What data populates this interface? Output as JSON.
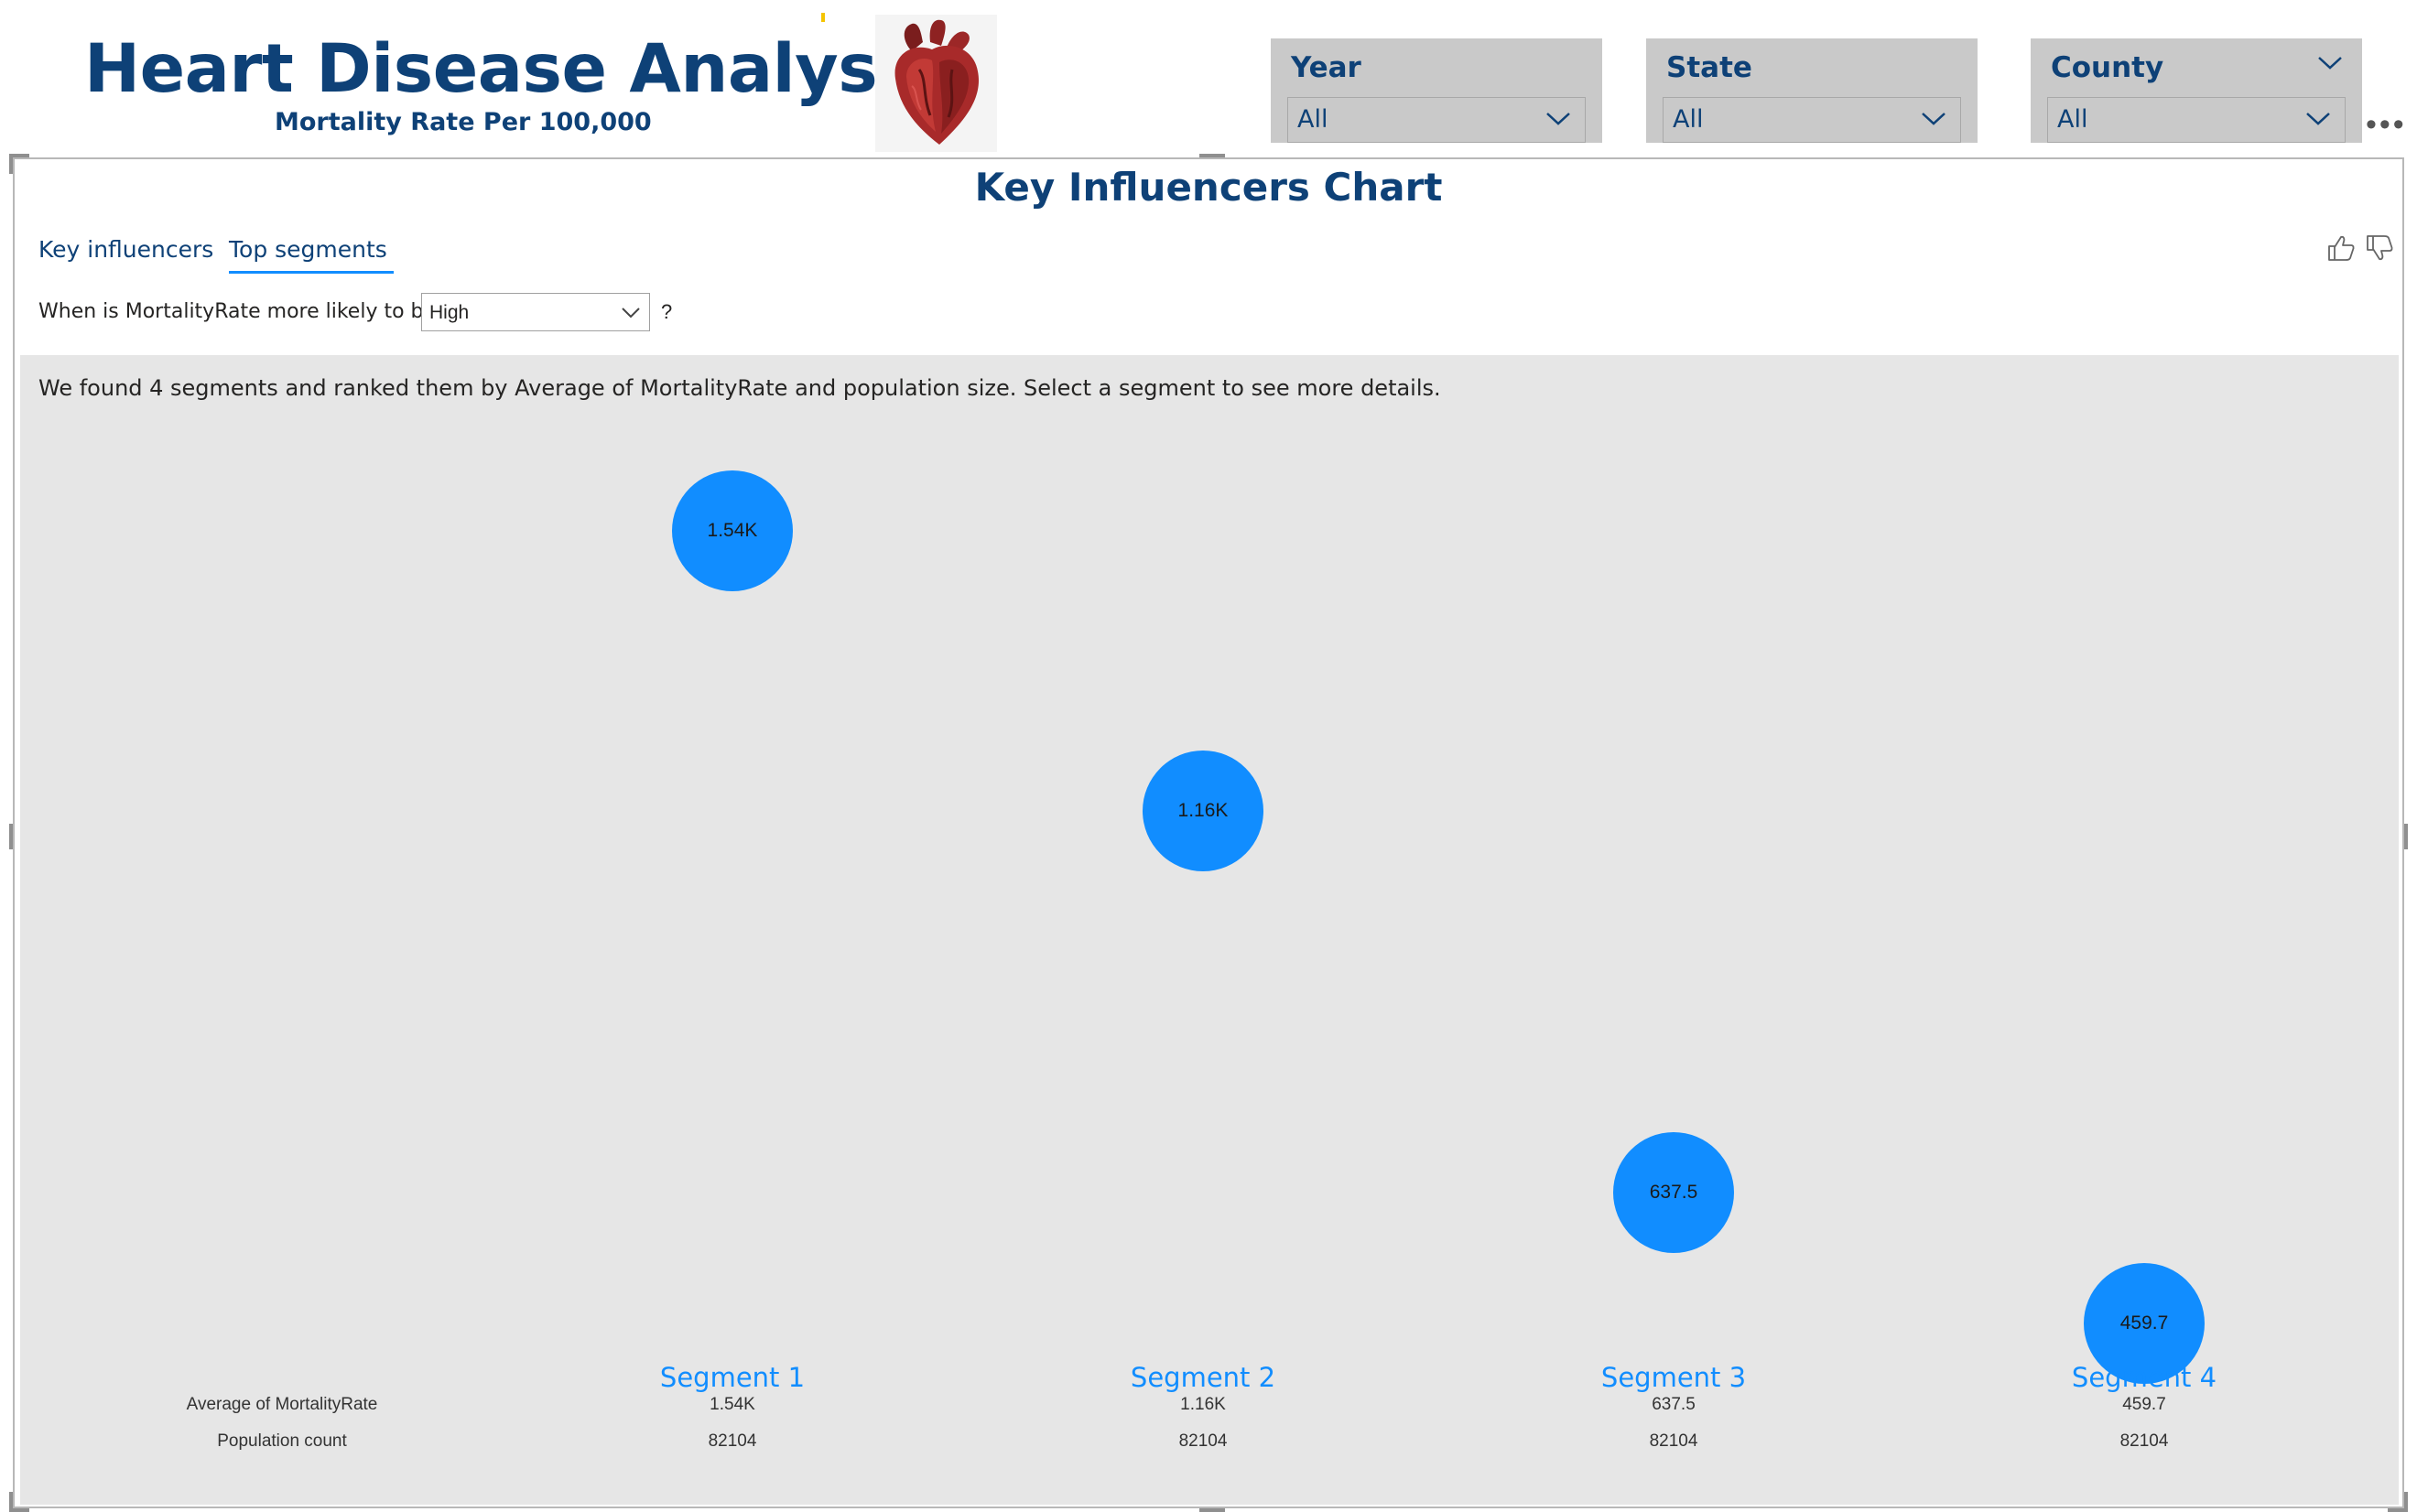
{
  "header": {
    "title": "Heart Disease Analysis",
    "subtitle": "Mortality Rate Per 100,000"
  },
  "slicers": [
    {
      "title": "Year",
      "value": "All"
    },
    {
      "title": "State",
      "value": "All"
    },
    {
      "title": "County",
      "value": "All"
    }
  ],
  "visual": {
    "title": "Key Influencers Chart",
    "tabs": [
      {
        "label": "Key influencers",
        "active": false
      },
      {
        "label": "Top segments",
        "active": true
      }
    ],
    "question_prefix": "When is MortalityRate more likely to be",
    "question_value": "High",
    "question_suffix": "?",
    "description": "We found 4 segments and ranked them by Average of MortalityRate and population size. Select a segment to see more details.",
    "row_labels": {
      "average": "Average of MortalityRate",
      "population": "Population count"
    }
  },
  "chart_data": {
    "type": "scatter",
    "title": "Key Influencers Chart",
    "x_categories": [
      "Segment 1",
      "Segment 2",
      "Segment 3",
      "Segment 4"
    ],
    "series": [
      {
        "name": "Average of MortalityRate",
        "values": [
          1540,
          1160,
          637.5,
          459.7
        ],
        "labels": [
          "1.54K",
          "1.16K",
          "637.5",
          "459.7"
        ]
      }
    ],
    "population": [
      "82104",
      "82104",
      "82104",
      "82104"
    ],
    "bubble_color": "#118dff"
  },
  "colors": {
    "brand": "#0e4177",
    "accent": "#118dff",
    "panel": "#e6e6e6",
    "slicer": "#c9c9c9"
  },
  "icons": [
    "heart-image",
    "chevron-down-icon",
    "thumbs-up-icon",
    "thumbs-down-icon",
    "more-options-icon"
  ]
}
